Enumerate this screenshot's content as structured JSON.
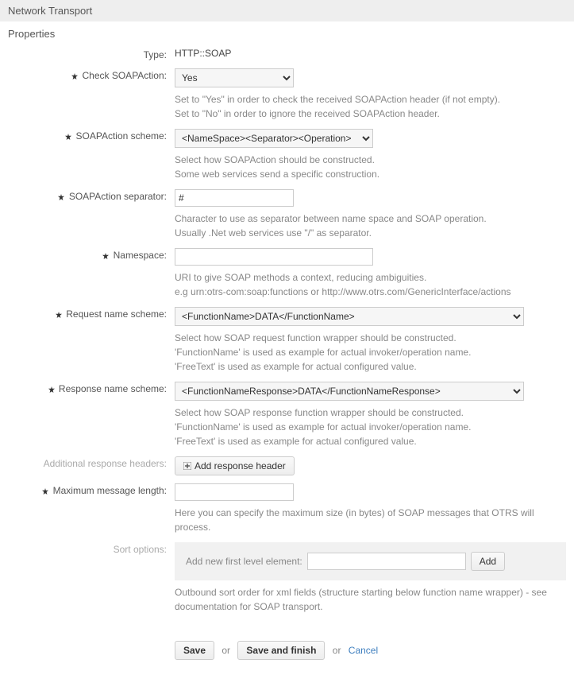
{
  "header": {
    "title": "Network Transport"
  },
  "section": {
    "title": "Properties"
  },
  "type": {
    "label": "Type:",
    "value": "HTTP::SOAP"
  },
  "check_soap": {
    "label": "Check SOAPAction:",
    "value": "Yes",
    "help1": "Set to \"Yes\" in order to check the received SOAPAction header (if not empty).",
    "help2": "Set to \"No\" in order to ignore the received SOAPAction header."
  },
  "soap_scheme": {
    "label": "SOAPAction scheme:",
    "value": "<NameSpace><Separator><Operation>",
    "help1": "Select how SOAPAction should be constructed.",
    "help2": "Some web services send a specific construction."
  },
  "soap_sep": {
    "label": "SOAPAction separator:",
    "value": "#",
    "help1": "Character to use as separator between name space and SOAP operation.",
    "help2": "Usually .Net web services use \"/\" as separator."
  },
  "namespace": {
    "label": "Namespace:",
    "value": "",
    "help1": "URI to give SOAP methods a context, reducing ambiguities.",
    "help2": "e.g urn:otrs-com:soap:functions or http://www.otrs.com/GenericInterface/actions"
  },
  "req_scheme": {
    "label": "Request name scheme:",
    "value": "<FunctionName>DATA</FunctionName>",
    "help1": "Select how SOAP request function wrapper should be constructed.",
    "help2": "'FunctionName' is used as example for actual invoker/operation name.",
    "help3": "'FreeText' is used as example for actual configured value."
  },
  "resp_scheme": {
    "label": "Response name scheme:",
    "value": "<FunctionNameResponse>DATA</FunctionNameResponse>",
    "help1": "Select how SOAP response function wrapper should be constructed.",
    "help2": "'FunctionName' is used as example for actual invoker/operation name.",
    "help3": "'FreeText' is used as example for actual configured value."
  },
  "add_headers": {
    "label": "Additional response headers:",
    "button": "Add response header"
  },
  "max_len": {
    "label": "Maximum message length:",
    "value": "",
    "help": "Here you can specify the maximum size (in bytes) of SOAP messages that OTRS will process."
  },
  "sort": {
    "label": "Sort options:",
    "panel_label": "Add new first level element:",
    "add_button": "Add",
    "help": "Outbound sort order for xml fields (structure starting below function name wrapper) - see documentation for SOAP transport."
  },
  "actions": {
    "save": "Save",
    "save_finish": "Save and finish",
    "cancel": "Cancel",
    "or": "or"
  }
}
